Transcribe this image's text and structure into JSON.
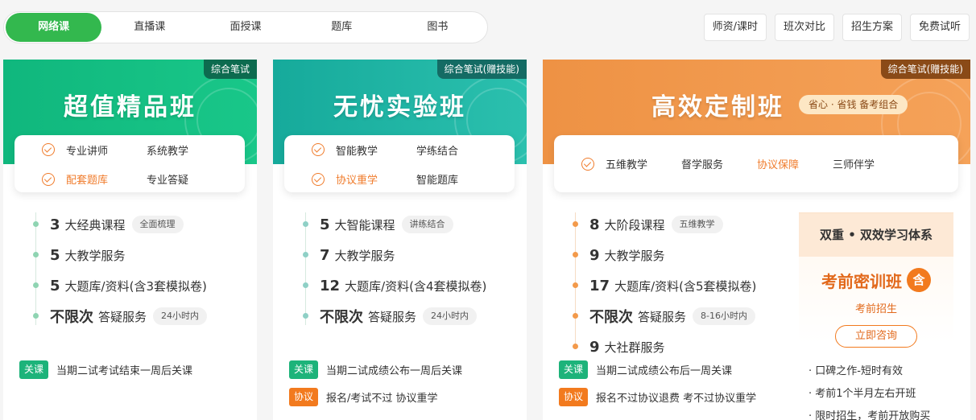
{
  "tabs": [
    "网络课",
    "直播课",
    "面授课",
    "题库",
    "图书"
  ],
  "right_buttons": [
    "师资/课时",
    "班次对比",
    "招生方案",
    "免费试听"
  ],
  "cards": [
    {
      "tag": "综合笔试",
      "title": "超值精品班",
      "features": [
        {
          "label": "专业讲师",
          "check": true,
          "hl": false
        },
        {
          "label": "系统教学",
          "check": false,
          "hl": false
        },
        {
          "label": "配套题库",
          "check": true,
          "hl": true
        },
        {
          "label": "专业答疑",
          "check": false,
          "hl": false
        }
      ],
      "items": [
        {
          "num": "3",
          "text": "大经典课程",
          "badge": "全面梳理"
        },
        {
          "num": "5",
          "text": "大教学服务",
          "badge": ""
        },
        {
          "num": "5",
          "text": "大题库/资料(含3套模拟卷)",
          "badge": ""
        },
        {
          "num": "不限次",
          "text": "答疑服务",
          "badge": "24小时内"
        }
      ],
      "notes": [
        {
          "tag": "关课",
          "text": "当期二试考试结束一周后关课"
        }
      ]
    },
    {
      "tag": "综合笔试(赠技能)",
      "title": "无忧实验班",
      "features": [
        {
          "label": "智能教学",
          "check": true,
          "hl": false
        },
        {
          "label": "学练结合",
          "check": false,
          "hl": false
        },
        {
          "label": "协议重学",
          "check": true,
          "hl": true
        },
        {
          "label": "智能题库",
          "check": false,
          "hl": false
        }
      ],
      "items": [
        {
          "num": "5",
          "text": "大智能课程",
          "badge": "讲练结合"
        },
        {
          "num": "7",
          "text": "大教学服务",
          "badge": ""
        },
        {
          "num": "12",
          "text": "大题库/资料(含4套模拟卷)",
          "badge": ""
        },
        {
          "num": "不限次",
          "text": "答疑服务",
          "badge": "24小时内"
        }
      ],
      "notes": [
        {
          "tag": "关课",
          "text": "当期二试成绩公布一周后关课"
        },
        {
          "tag": "协议",
          "text": "报名/考试不过 协议重学"
        }
      ]
    },
    {
      "tag": "综合笔试(赠技能)",
      "title": "高效定制班",
      "pill": "省心 · 省钱   备考组合",
      "features": [
        {
          "label": "五维教学",
          "check": true,
          "hl": false
        },
        {
          "label": "督学服务",
          "check": false,
          "hl": false
        },
        {
          "label": "协议保障",
          "check": false,
          "hl": true
        },
        {
          "label": "三师伴学",
          "check": false,
          "hl": false
        }
      ],
      "items": [
        {
          "num": "8",
          "text": "大阶段课程",
          "badge": "五维教学"
        },
        {
          "num": "9",
          "text": "大教学服务",
          "badge": ""
        },
        {
          "num": "17",
          "text": "大题库/资料(含5套模拟卷)",
          "badge": ""
        },
        {
          "num": "不限次",
          "text": "答疑服务",
          "badge": "8-16小时内"
        },
        {
          "num": "9",
          "text": "大社群服务",
          "badge": ""
        }
      ],
      "notes": [
        {
          "tag": "关课",
          "text": "当期二试成绩公布后一周关课"
        },
        {
          "tag": "协议",
          "text": "报名不过协议退费 考不过协议重学"
        }
      ],
      "side": {
        "heading": "双重 • 双效学习体系",
        "title": "考前密训班",
        "icon": "含",
        "sub": "考前招生",
        "button": "立即咨询",
        "bullets": [
          "· 口碑之作-短时有效",
          "· 考前1个半月左右开班",
          "· 限时招生，考前开放购买"
        ]
      }
    }
  ]
}
